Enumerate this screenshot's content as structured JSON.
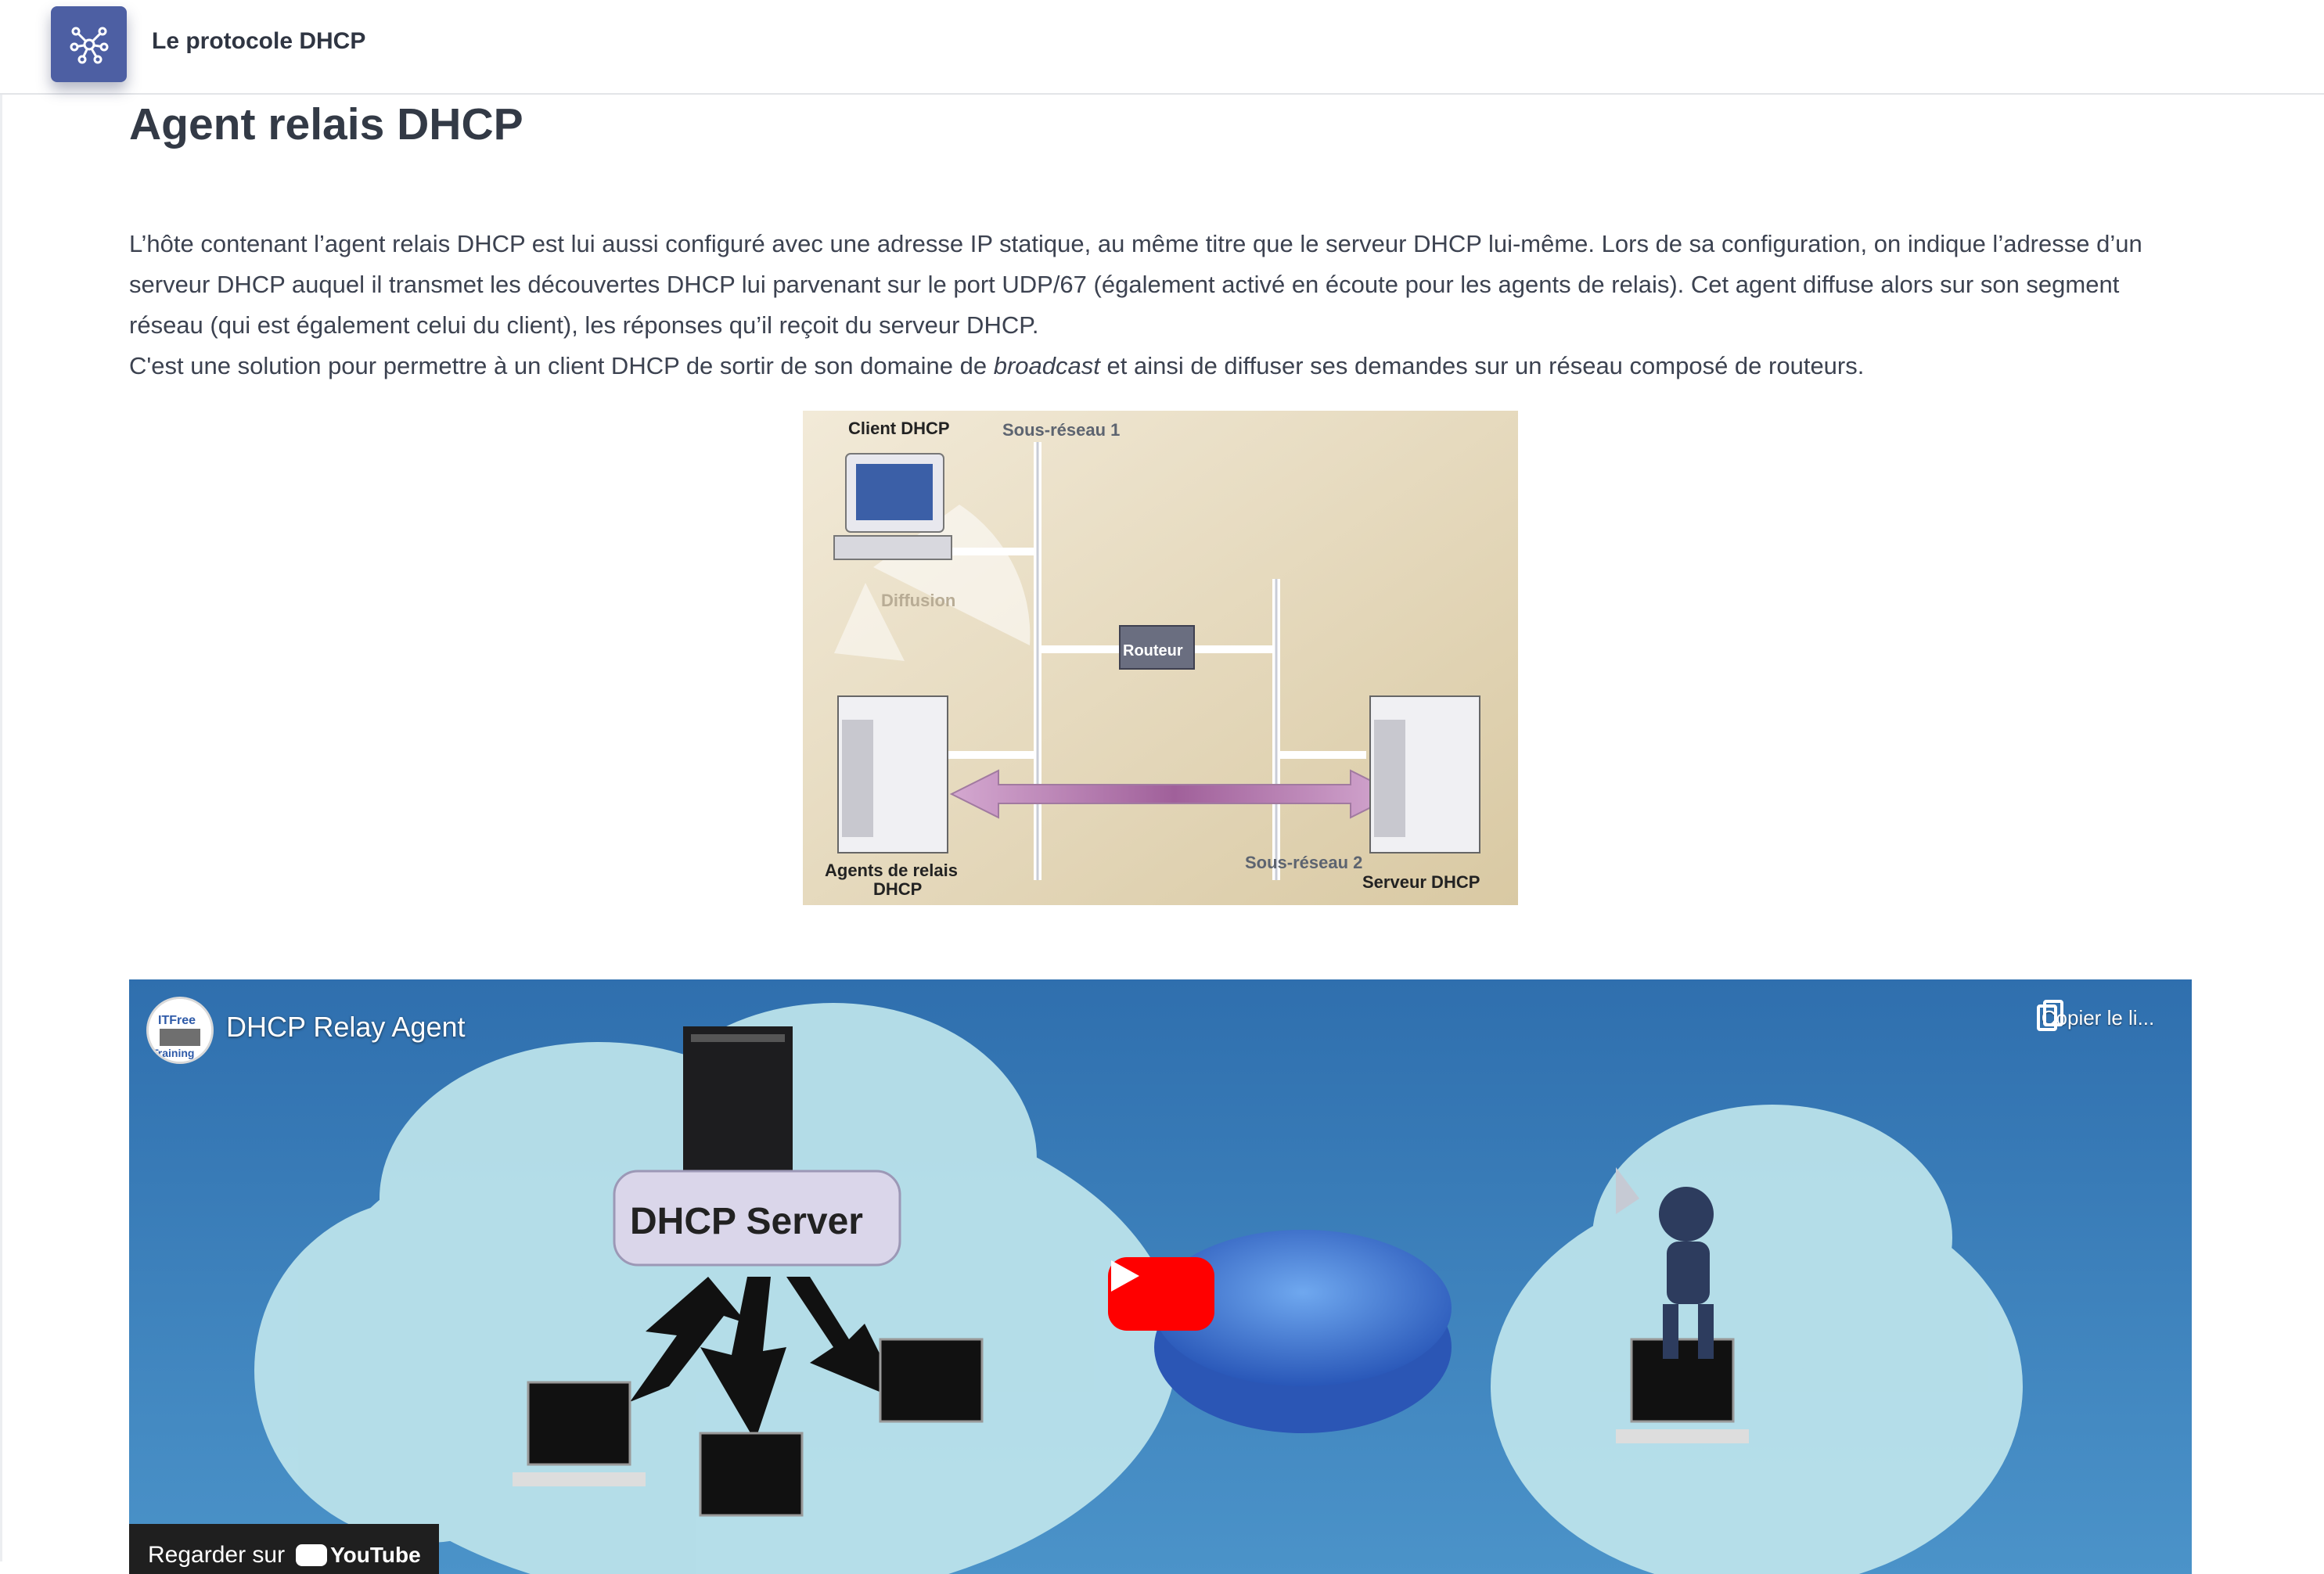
{
  "header": {
    "app_title": "Le protocole DHCP",
    "icon": "network-nodes-icon"
  },
  "page": {
    "heading": "Agent relais DHCP",
    "paragraph_part1": "L’hôte contenant l’agent relais DHCP est lui aussi configuré avec une adresse IP statique, au même titre que le serveur DHCP lui-même. Lors de sa configuration, on indique l’adresse d’un serveur DHCP auquel il transmet les découvertes DHCP lui parvenant sur le port UDP/67 (également activé en écoute pour les agents de relais). Cet agent diffuse alors sur son segment réseau (qui est également celui du client), les réponses qu’il reçoit du serveur DHCP.",
    "paragraph_line2_before": "C'est une solution pour permettre à un client DHCP de sortir de son domaine de ",
    "paragraph_line2_em": "broadcast",
    "paragraph_line2_after": " et ainsi de diffuser ses demandes sur un réseau composé de routeurs."
  },
  "figure": {
    "client_label": "Client DHCP",
    "subnet1_label": "Sous-réseau 1",
    "broadcast_label": "Diffusion",
    "router_label": "Routeur",
    "relay_label_line1": "Agents de relais",
    "relay_label_line2": "DHCP",
    "subnet2_label": "Sous-réseau 2",
    "server_label": "Serveur  DHCP"
  },
  "video": {
    "title": "DHCP Relay Agent",
    "channel_avatar_text": "ITFree\nTraining",
    "copy_label": "Copier le li...",
    "server_label": "DHCP Server",
    "watch_label": "Regarder sur",
    "youtube_label": "YouTube",
    "colors": {
      "background": "#3f86c0",
      "play": "#ff0000"
    }
  }
}
